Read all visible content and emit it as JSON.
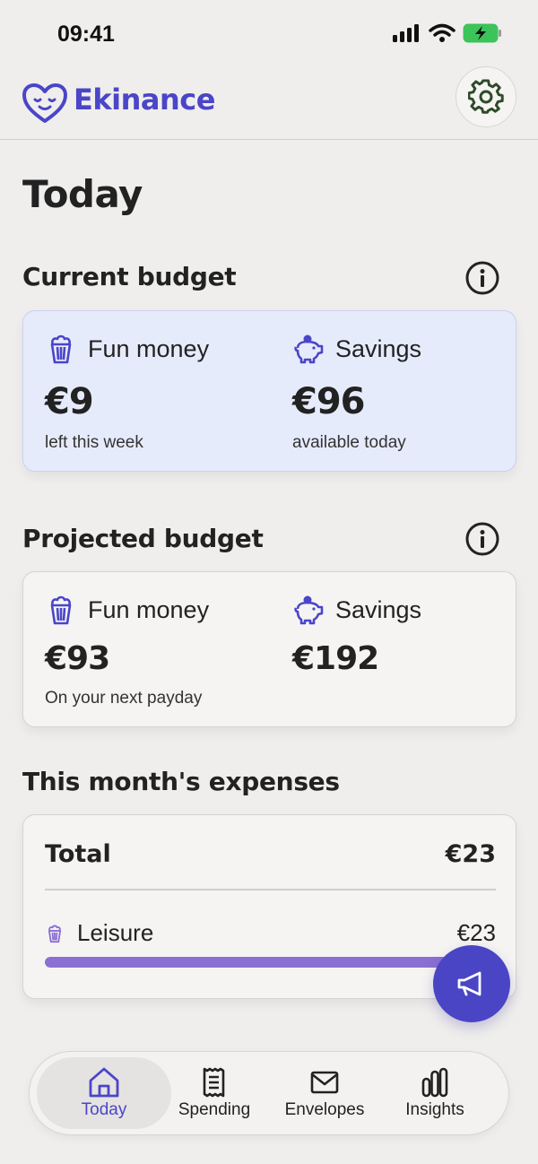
{
  "status_bar": {
    "time": "09:41"
  },
  "header": {
    "app_name": "Ekinance",
    "brand_color": "#4b45c9"
  },
  "page": {
    "title": "Today"
  },
  "current_budget": {
    "title": "Current budget",
    "fun_money": {
      "label": "Fun money",
      "amount": "€9",
      "caption": "left this week"
    },
    "savings": {
      "label": "Savings",
      "amount": "€96",
      "caption": "available today"
    }
  },
  "projected_budget": {
    "title": "Projected budget",
    "fun_money": {
      "label": "Fun money",
      "amount": "€93",
      "caption": "On your next payday"
    },
    "savings": {
      "label": "Savings",
      "amount": "€192"
    }
  },
  "expenses": {
    "title": "This month's expenses",
    "total_label": "Total",
    "total_value": "€23",
    "categories": [
      {
        "label": "Leisure",
        "value": "€23",
        "share": 1.0,
        "color": "#8b6fd3"
      }
    ]
  },
  "nav": {
    "items": [
      {
        "label": "Today",
        "icon": "home-icon",
        "active": true
      },
      {
        "label": "Spending",
        "icon": "receipt-icon"
      },
      {
        "label": "Envelopes",
        "icon": "envelope-icon"
      },
      {
        "label": "Insights",
        "icon": "bar-chart-icon"
      }
    ]
  }
}
